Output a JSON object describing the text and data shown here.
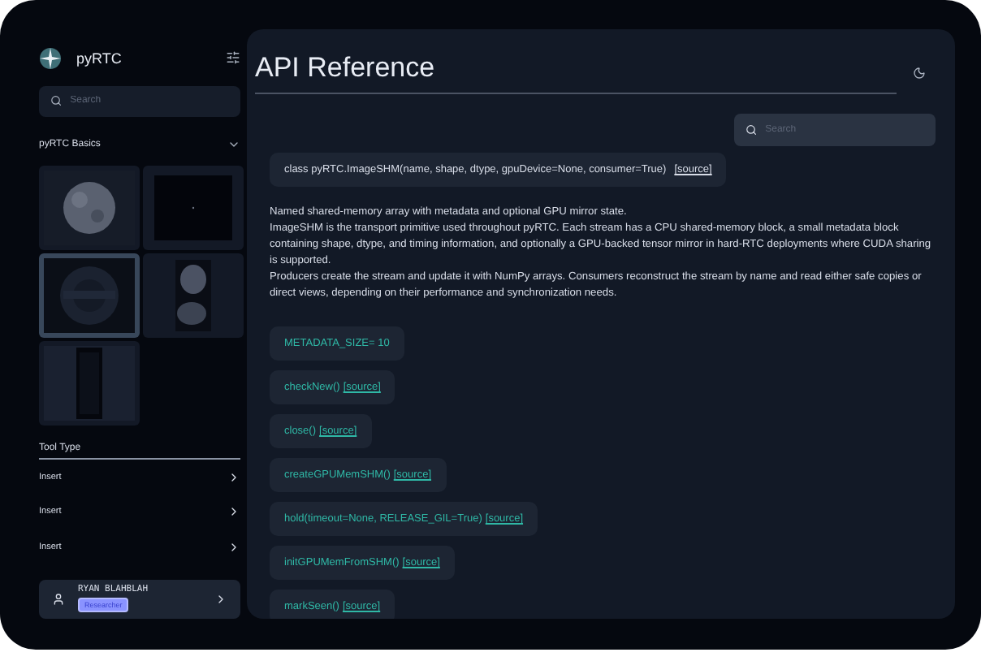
{
  "sidebar": {
    "brand": "pyRTC",
    "search": {
      "placeholder": "Search"
    },
    "section": {
      "title": "pyRTC Basics",
      "expanded": true
    },
    "thumbnails": [
      {
        "kind": "moon",
        "selected": false
      },
      {
        "kind": "dot",
        "selected": false
      },
      {
        "kind": "grid",
        "selected": true
      },
      {
        "kind": "speckle",
        "selected": false
      },
      {
        "kind": "strip",
        "selected": false
      }
    ],
    "tool_type": {
      "title": "Tool Type",
      "items": [
        "Insert",
        "Insert",
        "Insert"
      ]
    },
    "user": {
      "name": "RYAN  BLAHBLAH",
      "role": "Researcher"
    }
  },
  "main": {
    "title": "API Reference",
    "search": {
      "placeholder": "Search"
    },
    "class_signature": "class pyRTC.ImageSHM(name, shape, dtype, gpuDevice=None, consumer=True)",
    "class_link": "[source]",
    "paragraphs": [
      "Named shared-memory array with metadata and optional GPU mirror state.",
      "ImageSHM is the transport primitive used throughout pyRTC. Each stream has a CPU shared-memory block, a small metadata block containing shape, dtype, and timing information, and optionally a GPU-backed tensor mirror in hard-RTC deployments where CUDA sharing is supported.",
      "Producers create the stream and update it with NumPy arrays. Consumers reconstruct the stream by name and read either safe copies or direct views, depending on their performance and synchronization needs."
    ],
    "members": [
      {
        "signature": "METADATA_SIZE= 10"
      },
      {
        "signature": "checkNew()",
        "link": "[source]"
      },
      {
        "signature": "close()",
        "link": "[source]"
      },
      {
        "signature": "createGPUMemSHM()",
        "link": "[source]"
      },
      {
        "signature": "hold(timeout=None, RELEASE_GIL=True)",
        "link": "[source]"
      },
      {
        "signature": "initGPUMemFromSHM()",
        "link": "[source]"
      },
      {
        "signature": "markSeen()",
        "link": "[source]"
      }
    ]
  }
}
